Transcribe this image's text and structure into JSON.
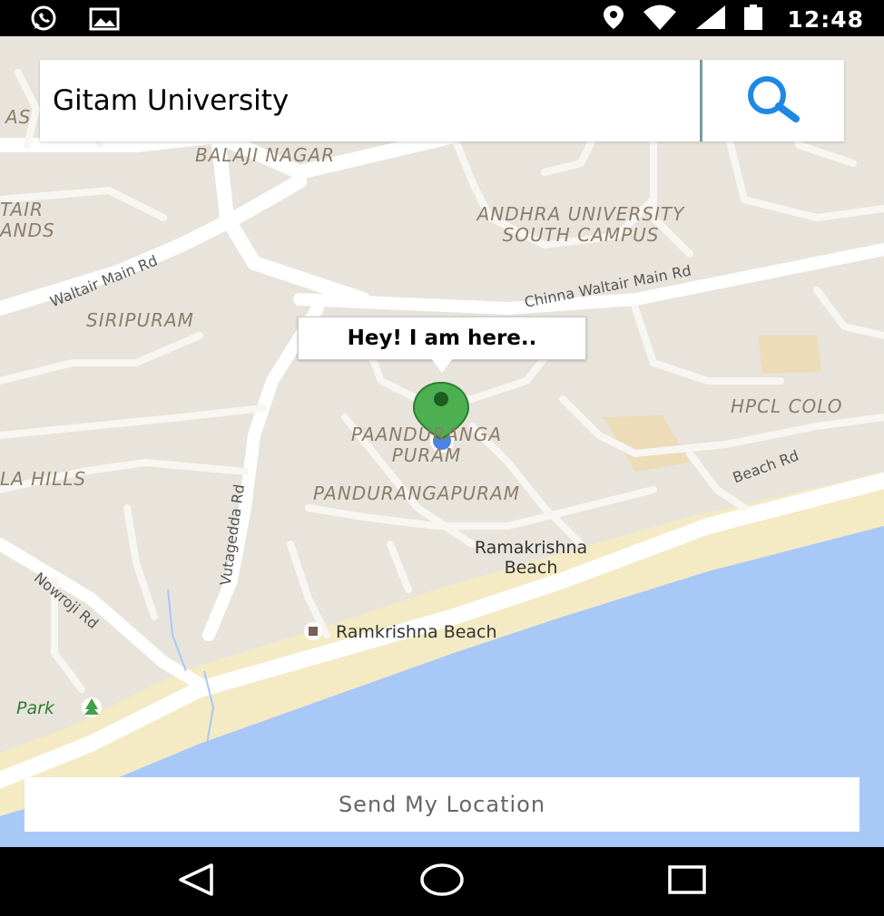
{
  "status_bar": {
    "time": "12:48",
    "icons": [
      "whatsapp-icon",
      "image-icon",
      "location-icon",
      "wifi-icon",
      "signal-icon",
      "battery-icon"
    ]
  },
  "search": {
    "value": "Gitam University",
    "button_icon": "search-icon",
    "accent_color": "#1e88e5"
  },
  "map": {
    "area_labels": [
      "BALAJI NAGAR",
      "ANDHRA UNIVERSITY SOUTH CAMPUS",
      "SIRIPURAM",
      "HPCL COLO",
      "PAANDURANGA PURAM",
      "PANDURANGAPURAM",
      "LA HILLS",
      "AS",
      "TAIR ANDS"
    ],
    "road_labels": [
      "Waltair Main Rd",
      "Chinna Waltair Main Rd",
      "Beach Rd",
      "Vutagedda Rd",
      "Nowroji Rd"
    ],
    "poi_labels": [
      "Ramakrishna Beach",
      "Ramkrishna Beach"
    ],
    "park_label": "Park",
    "marker_color": "#4caf50",
    "location_dot_color": "#4a84e8",
    "water_color": "#a8c8f8"
  },
  "info_window": {
    "text": "Hey! I am here.."
  },
  "actions": {
    "send_location": "Send My Location"
  },
  "nav_bar": {
    "icons": [
      "back-icon",
      "home-icon",
      "recents-icon"
    ]
  }
}
